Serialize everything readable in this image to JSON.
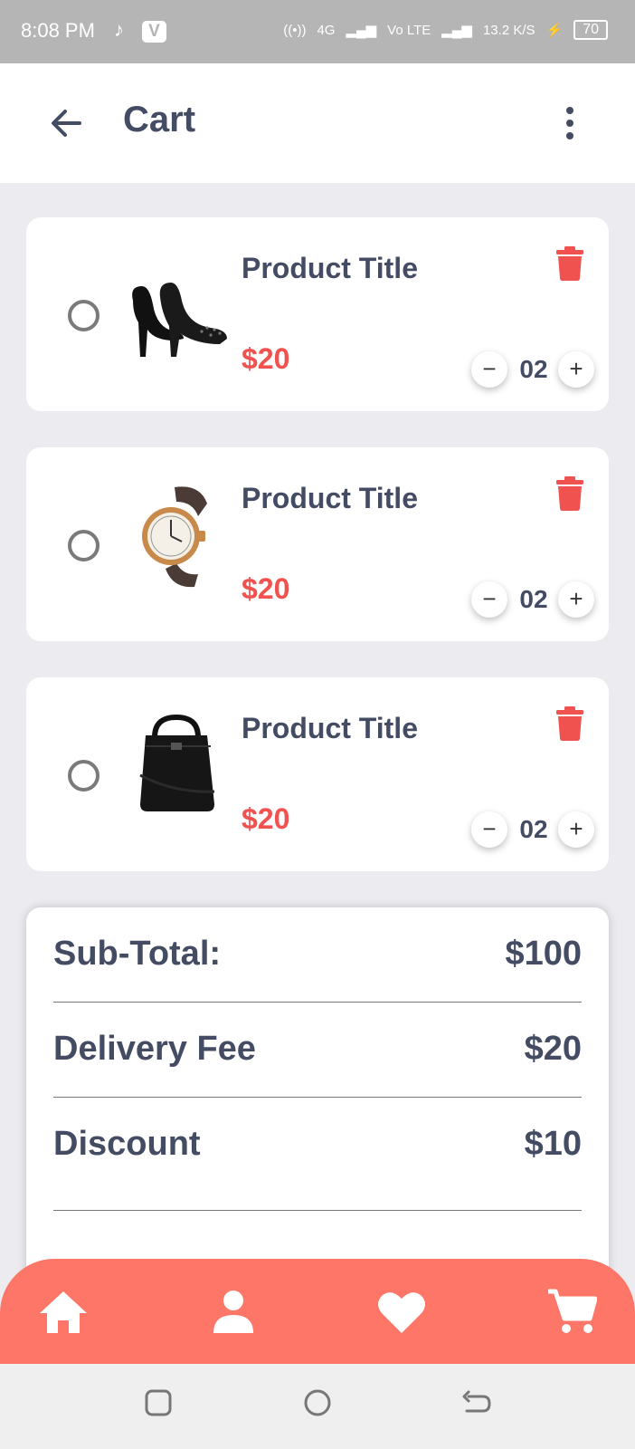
{
  "status_bar": {
    "time": "8:08 PM",
    "app_badge": "V",
    "network_4g": "4G",
    "volte": "Vo LTE",
    "speed": "13.2 K/S",
    "battery": "70"
  },
  "app_bar": {
    "title": "Cart",
    "back_icon": "arrow-left-icon",
    "menu_icon": "more-vert-icon"
  },
  "cart_items": [
    {
      "image": "black-high-heel-shoes",
      "title": "Product Title",
      "price": "$20",
      "quantity": "02"
    },
    {
      "image": "wristwatch",
      "title": "Product Title",
      "price": "$20",
      "quantity": "02"
    },
    {
      "image": "black-leather-bag",
      "title": "Product Title",
      "price": "$20",
      "quantity": "02"
    }
  ],
  "stepper": {
    "minus": "−",
    "plus": "+"
  },
  "summary": {
    "subtotal_label": "Sub-Total:",
    "subtotal_value": "$100",
    "delivery_label": "Delivery Fee",
    "delivery_value": "$20",
    "discount_label": "Discount",
    "discount_value": "$10"
  },
  "bottom_nav": [
    "home-icon",
    "person-icon",
    "heart-icon",
    "cart-icon"
  ],
  "colors": {
    "accent": "#fe7667",
    "price": "#f0524f",
    "text": "#444c63",
    "background": "#ebebf0"
  }
}
